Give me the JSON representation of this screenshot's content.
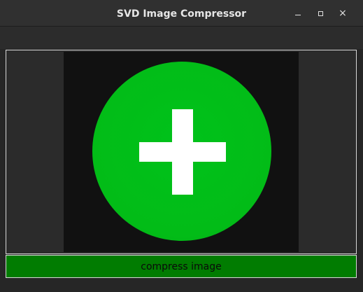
{
  "window": {
    "title": "SVD Image Compressor",
    "controls": {
      "minimize_icon": "minimize-icon",
      "maximize_icon": "maximize-icon",
      "close_glyph": "×"
    }
  },
  "image_panel": {
    "placeholder_icon": "add-circle-icon",
    "icon_color": "#02bc17"
  },
  "actions": {
    "compress_label": "compress image",
    "compress_color": "#017c01"
  }
}
